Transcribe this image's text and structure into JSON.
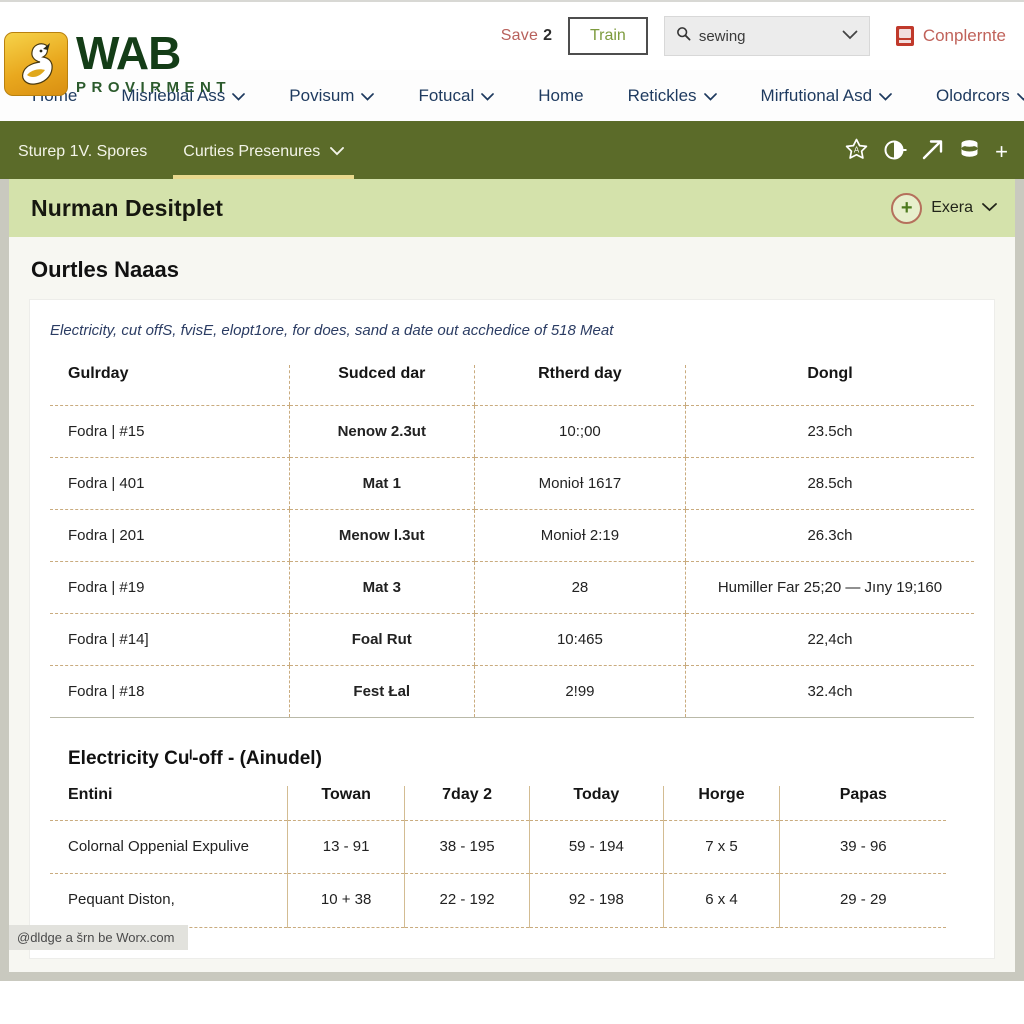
{
  "topbar": {
    "save_label": "Save",
    "save_count": "2",
    "train_label": "Train",
    "search": {
      "icon": "search-icon",
      "value": "sewing",
      "chevron": "chevron-down-icon"
    },
    "complete_label": "Conplernte",
    "complete_icon": "book-icon"
  },
  "brand": {
    "logo_icon": "swan-logo-icon",
    "name": "WAB",
    "tagline": "PROVIRMENT"
  },
  "mainnav": {
    "items": [
      {
        "label": "Home",
        "caret": false
      },
      {
        "label": "Misriebial Ass",
        "caret": true
      },
      {
        "label": "Povisum",
        "caret": true
      },
      {
        "label": "Fotucal",
        "caret": true
      },
      {
        "label": "Home",
        "caret": false
      },
      {
        "label": "Retickles",
        "caret": true
      },
      {
        "label": "Mirfutional Asd",
        "caret": true
      },
      {
        "label": "Olodrcors",
        "caret": true
      }
    ]
  },
  "subnav": {
    "tabs": [
      {
        "label": "Sturep 1V. Spores",
        "caret": false,
        "active": false
      },
      {
        "label": "Curties Presenures",
        "caret": true,
        "active": true
      }
    ],
    "icons": [
      "star-badge-icon",
      "contrast-icon",
      "arrow-up-right-icon",
      "database-icon",
      "plus-icon"
    ]
  },
  "banner": {
    "title": "Nurman Desitplet",
    "extra_label": "Exera",
    "plus_icon": "plus-circle-icon",
    "chevron": "chevron-down-icon"
  },
  "page_heading": "Ourtles Naaas",
  "lead": "Electricity, cut offS, fvisE, elopt1ore, for does, sand a date out acchedice of 518 Meat",
  "table_main": {
    "columns": [
      "Gulrday",
      "Sudced dar",
      "Rtherd day",
      "Dongl"
    ],
    "rows": [
      [
        "Fodra | #15",
        "Nenow 2.3ut",
        "10:;00",
        "23.5ch"
      ],
      [
        "Fodra | 401",
        "Mat 1",
        "MonioƗ 1617",
        "28.5ch"
      ],
      [
        "Fodra | 201",
        "Menow l.3ut",
        "MonioƗ 2:19",
        "26.3ch"
      ],
      [
        "Fodra | #19",
        "Mat 3",
        "28",
        "Humiller Far 25;20 — Jıny 19;160"
      ],
      [
        "Fodra | #14]",
        "Foal Rut",
        "10:465",
        "22,4ch"
      ],
      [
        "Fodra | #18",
        "Fest Łal",
        "2!99",
        "32.4ch"
      ]
    ]
  },
  "table_second": {
    "title": "Electricity Cuˡ-off - (Ainudel)",
    "columns": [
      "Entini",
      "Towan",
      "7day 2",
      "Today",
      "Horge",
      "Papas"
    ],
    "rows": [
      [
        "Colornal Oppenial Expulive",
        "13 - 91",
        "38 - 195",
        "59 - 194",
        "7 x 5",
        "39 - 96"
      ],
      [
        "Pequant Diston,",
        "10 + 38",
        "22 - 192",
        "92 - 198",
        "6 x 4",
        "29 - 29"
      ]
    ]
  },
  "statusbar": "@dldge a šrn be Worx.com"
}
